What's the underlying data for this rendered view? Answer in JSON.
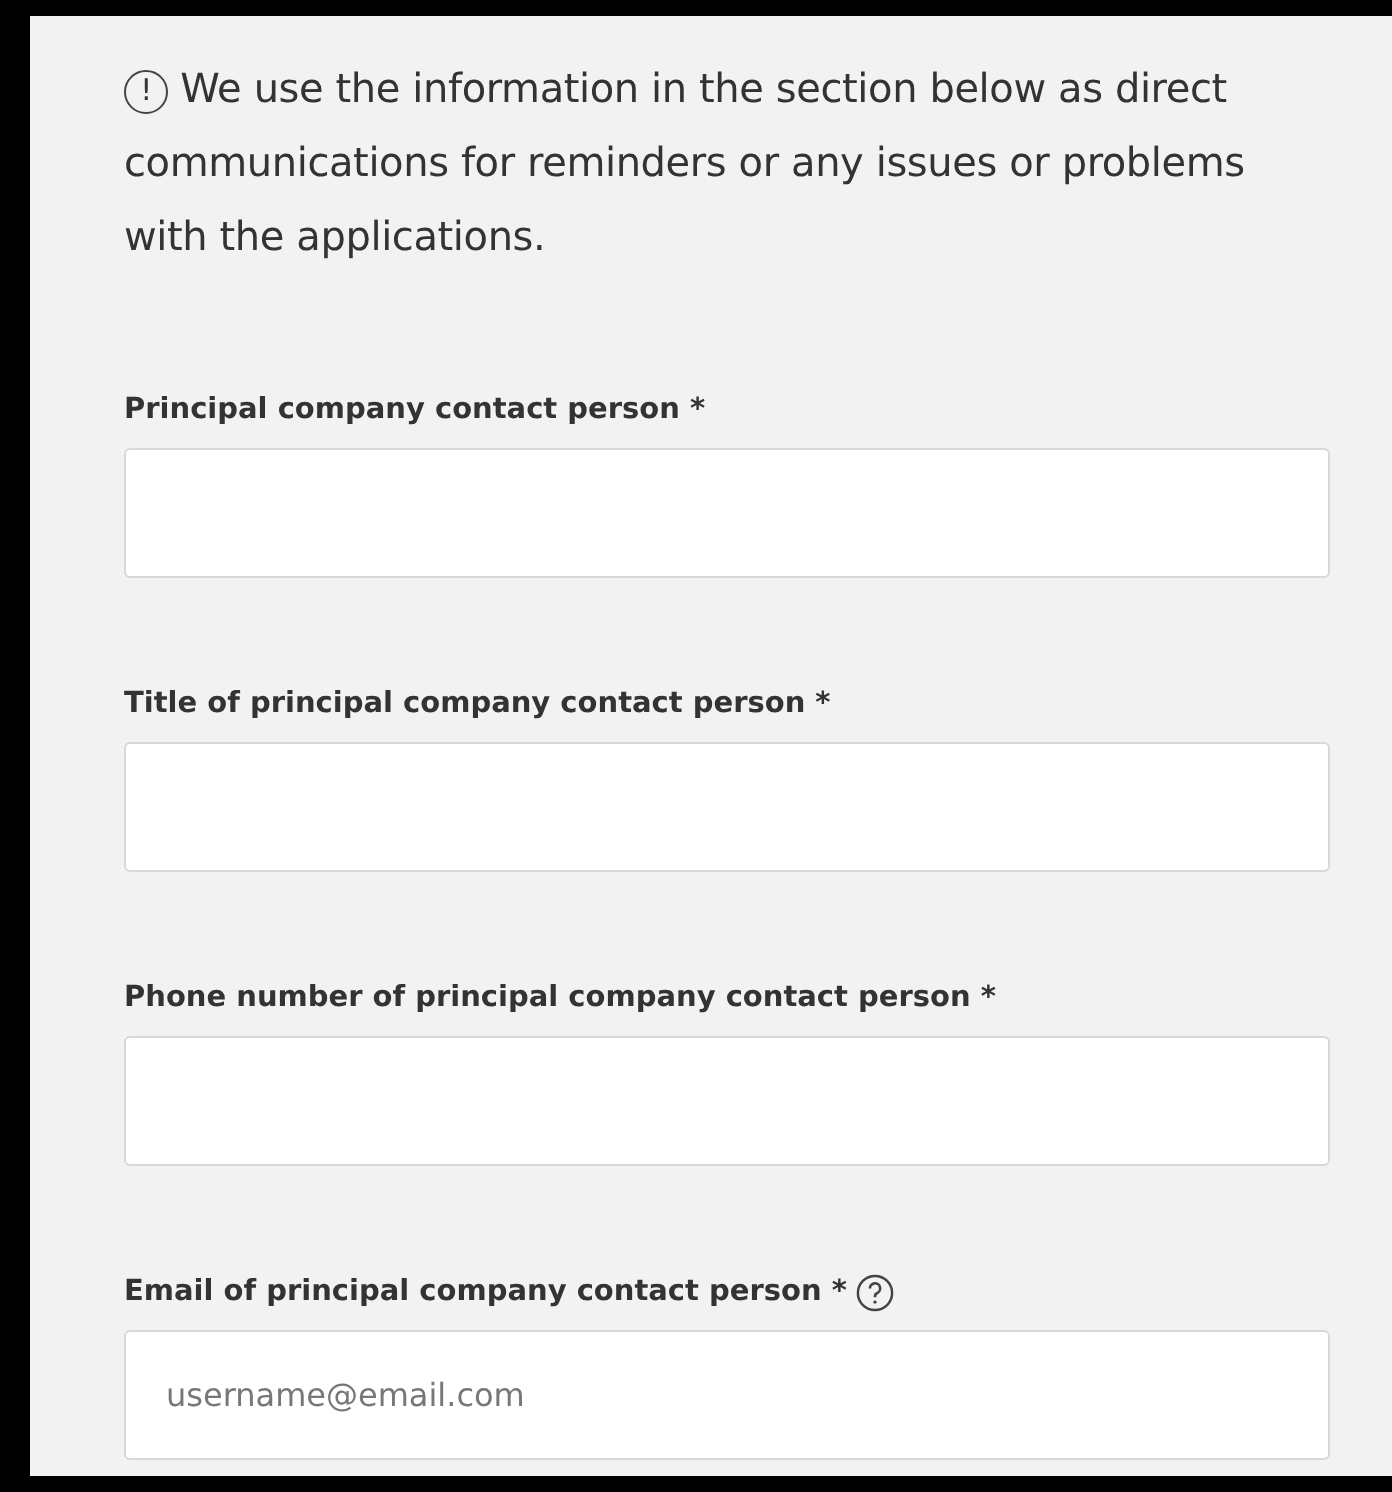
{
  "notice": {
    "icon": "!",
    "text": "We use the information in the section below as direct communications for reminders or any issues or problems with the applications."
  },
  "fields": [
    {
      "label": "Principal company contact person *",
      "help": false
    },
    {
      "label": "Title of principal company contact person *",
      "help": false
    },
    {
      "label": "Phone number of principal company contact person *",
      "help": false
    },
    {
      "label": "Email of principal company contact person *",
      "help": true,
      "placeholder": "username@email.com"
    }
  ]
}
